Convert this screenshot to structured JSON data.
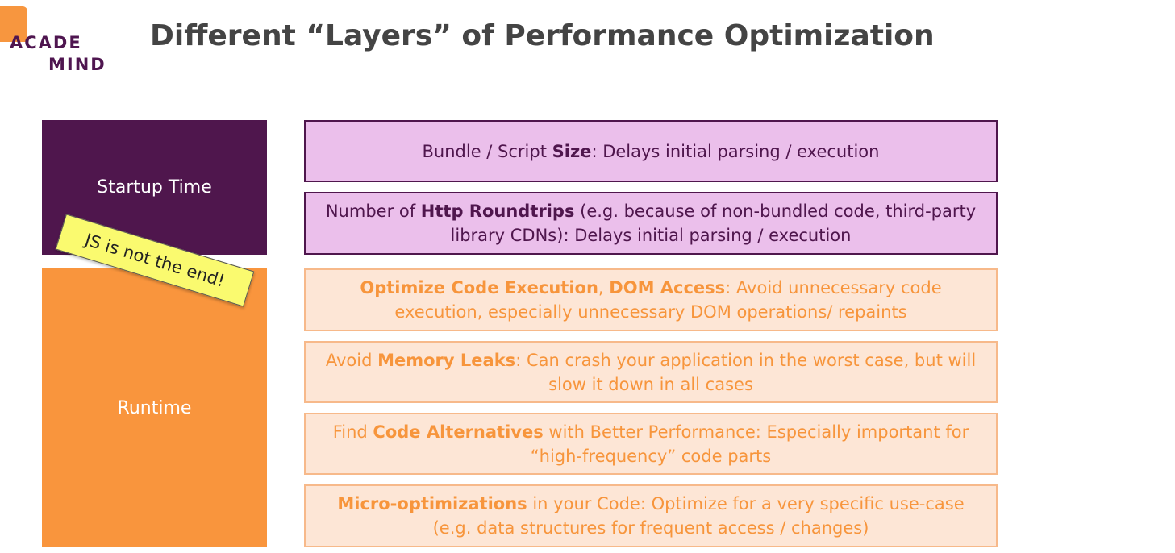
{
  "logo": {
    "line1": "ACADE",
    "line2": "MIND"
  },
  "title": "Different “Layers” of Performance Optimization",
  "categories": {
    "startup": "Startup Time",
    "runtime": "Runtime"
  },
  "sticky_note": "JS is not the end!",
  "items": [
    {
      "pre": "Bundle / Script ",
      "bold": "Size",
      "post": ": Delays initial parsing / execution"
    },
    {
      "pre": "Number of ",
      "bold": "Http Roundtrips",
      "post": " (e.g. because of non-bundled code, third-party library CDNs): Delays initial parsing / execution"
    },
    {
      "pre": "",
      "bold": "Optimize Code Execution",
      "mid": ", ",
      "bold2": "DOM Access",
      "post": ": Avoid unnecessary code execution, especially unnecessary DOM operations/ repaints"
    },
    {
      "pre": "Avoid ",
      "bold": "Memory Leaks",
      "post": ": Can crash your application in the worst case, but will slow it down in all cases"
    },
    {
      "pre": "Find ",
      "bold": "Code Alternatives",
      "post": " with Better Performance: Especially important for “high-frequency” code parts"
    },
    {
      "pre": "",
      "bold": "Micro-optimizations",
      "post": " in your Code: Optimize for a very specific use-case (e.g. data structures for frequent access / changes)"
    }
  ],
  "colors": {
    "startup": "#4f164d",
    "runtime": "#f9953d",
    "item_purple_bg": "#ebbfeb",
    "item_orange_bg": "#fde6d6",
    "sticky": "#fafa6f"
  }
}
